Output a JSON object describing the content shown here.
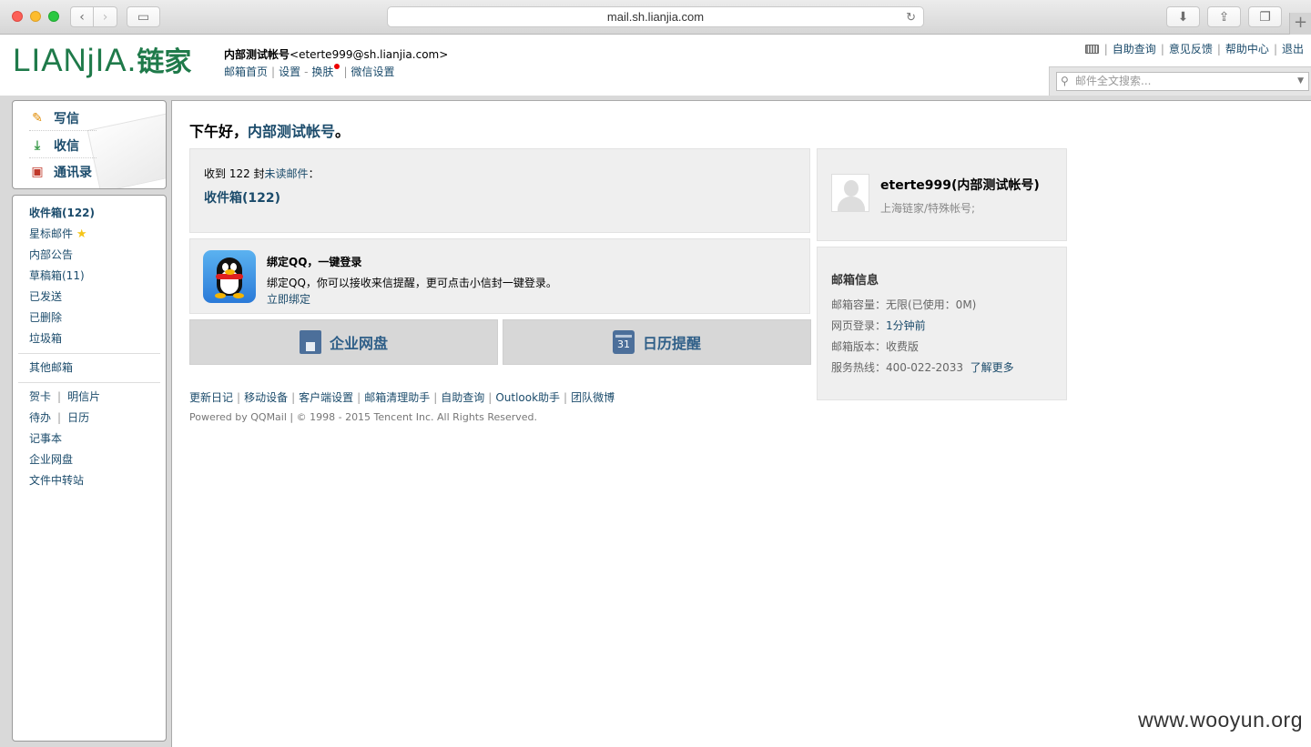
{
  "browser": {
    "url": "mail.sh.lianjia.com"
  },
  "header": {
    "logo_text": "LIANjIA.",
    "logo_cn": "链家",
    "account_name": "内部测试帐号",
    "account_email": "<eterte999@sh.lianjia.com>",
    "links": [
      "邮箱首页",
      "设置",
      "换肤",
      "微信设置"
    ],
    "top_links": [
      "自助查询",
      "意见反馈",
      "帮助中心",
      "退出"
    ],
    "search_placeholder": "邮件全文搜索..."
  },
  "quick_actions": [
    "写信",
    "收信",
    "通讯录"
  ],
  "sidebar": {
    "folders": [
      "收件箱(122)",
      "星标邮件",
      "内部公告",
      "草稿箱(11)",
      "已发送",
      "已删除",
      "垃圾箱"
    ],
    "other": "其他邮箱",
    "tools": {
      "greeting_card": "贺卡",
      "postcard": "明信片",
      "todo": "待办",
      "calendar": "日历",
      "notes": "记事本",
      "netdisk": "企业网盘",
      "transfer": "文件中转站"
    }
  },
  "main": {
    "greeting_prefix": "下午好，",
    "greeting_name": "内部测试帐号",
    "greeting_suffix": "。",
    "unread_prefix": "收到 122 封",
    "unread_link": "未读邮件",
    "unread_suffix": "：",
    "inbox_link": "收件箱(122)",
    "qq_title": "绑定QQ，一键登录",
    "qq_desc": "绑定QQ，你可以接收来信提醒，更可点击小信封一键登录。",
    "qq_link": "立即绑定",
    "tile_disk": "企业网盘",
    "tile_calendar": "日历提醒",
    "calendar_day": "31",
    "footer_links": [
      "更新日记",
      "移动设备",
      "客户端设置",
      "邮箱清理助手",
      "自助查询",
      "Outlook助手",
      "团队微博"
    ],
    "powered": "Powered by QQMail  | © 1998 - 2015 Tencent Inc. All Rights Reserved."
  },
  "profile": {
    "name": "eterte999(内部测试帐号)",
    "org": "上海链家/特殊帐号;"
  },
  "mailbox_info": {
    "title": "邮箱信息",
    "capacity": "邮箱容量：无限(已使用：0M)",
    "login_label": "网页登录：",
    "login_value": "1分钟前",
    "version": "邮箱版本：收费版",
    "hotline": "服务热线：400-022-2033",
    "learn_more": "了解更多"
  },
  "watermark": "www.wooyun.org",
  "colors": {
    "link": "#1b4b6b",
    "logo": "#1f7a4a",
    "panel": "#efefef"
  }
}
